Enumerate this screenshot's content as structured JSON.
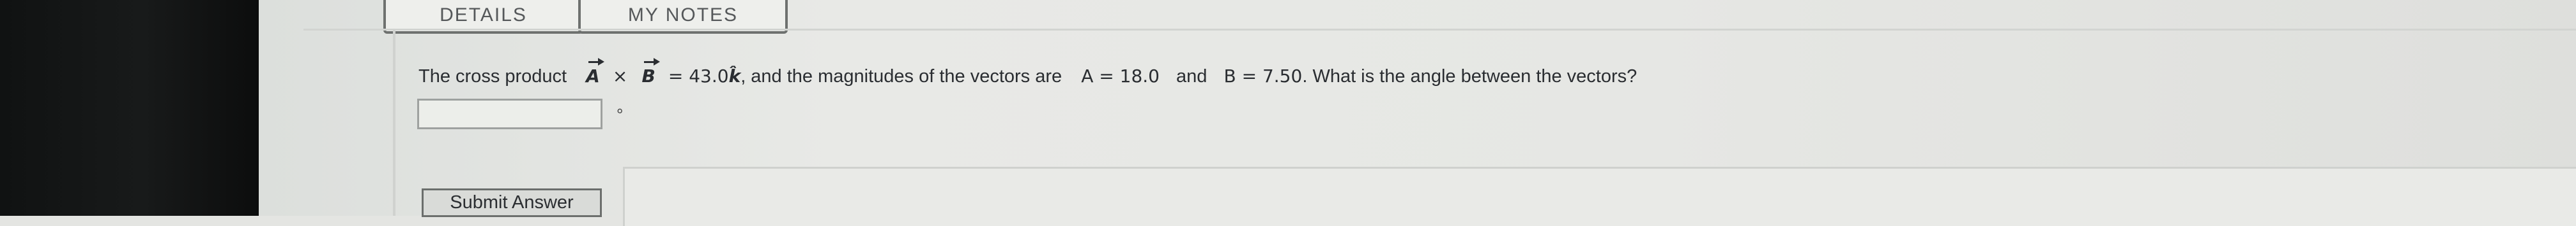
{
  "tabs": {
    "details": "DETAILS",
    "notes": "MY NOTES"
  },
  "question": {
    "part1": "The cross product",
    "vec_a": "A",
    "times": "×",
    "vec_b": "B",
    "equals_value": "= 43.0",
    "k_hat": "k̂",
    "part2": ", and the magnitudes of the vectors are",
    "a_mag": "A = 18.0",
    "and": "and",
    "b_mag": "B = 7.50",
    "part3": ". What is the angle between the vectors?"
  },
  "answer": {
    "value": "",
    "unit": "°"
  },
  "submit_label": "Submit Answer"
}
